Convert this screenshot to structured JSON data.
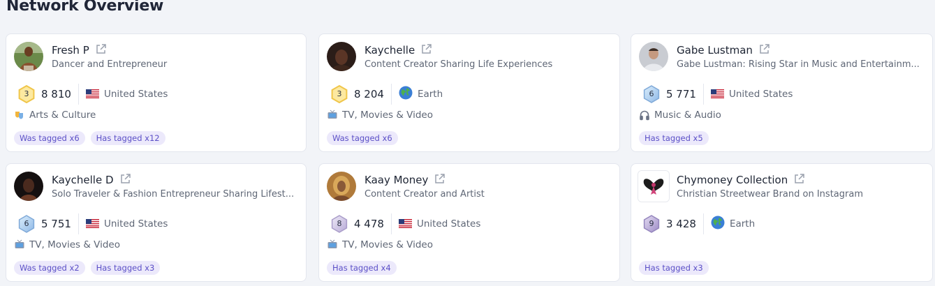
{
  "page": {
    "title": "Network Overview"
  },
  "cards": [
    {
      "name": "Fresh P",
      "desc": "Dancer and Entrepreneur",
      "level": "3",
      "count": "8 810",
      "location": "United States",
      "category": "Arts & Culture",
      "tags": [
        "Was tagged x6",
        "Has tagged x12"
      ]
    },
    {
      "name": "Kaychelle",
      "desc": "Content Creator Sharing Life Experiences",
      "level": "3",
      "count": "8 204",
      "location": "Earth",
      "category": "TV, Movies & Video",
      "tags": [
        "Was tagged x6"
      ]
    },
    {
      "name": "Gabe Lustman",
      "desc": "Gabe Lustman: Rising Star in Music and Entertainm...",
      "level": "6",
      "count": "5 771",
      "location": "United States",
      "category": "Music & Audio",
      "tags": [
        "Has tagged x5"
      ]
    },
    {
      "name": "Kaychelle D",
      "desc": "Solo Traveler & Fashion Entrepreneur Sharing Lifest...",
      "level": "6",
      "count": "5 751",
      "location": "United States",
      "category": "TV, Movies & Video",
      "tags": [
        "Was tagged x2",
        "Has tagged x3"
      ]
    },
    {
      "name": "Kaay Money",
      "desc": "Content Creator and Artist",
      "level": "8",
      "count": "4 478",
      "location": "United States",
      "category": "TV, Movies & Video",
      "tags": [
        "Has tagged x4"
      ]
    },
    {
      "name": "Chymoney Collection",
      "desc": "Christian Streetwear Brand on Instagram",
      "level": "9",
      "count": "3 428",
      "location": "Earth",
      "category": "",
      "tags": [
        "Has tagged x3"
      ]
    }
  ],
  "colors": {
    "tag_bg": "#ece9fb",
    "tag_text": "#5b4fc7",
    "level_gold": "#f5d060",
    "level_blue": "#9cc8ee",
    "level_purple": "#b9a9d8"
  },
  "icons": {
    "external": "external-link-icon",
    "us_flag": "us-flag-icon",
    "earth": "earth-globe-icon",
    "arts": "theater-masks-icon",
    "tv": "tv-icon",
    "music": "headphones-icon"
  }
}
